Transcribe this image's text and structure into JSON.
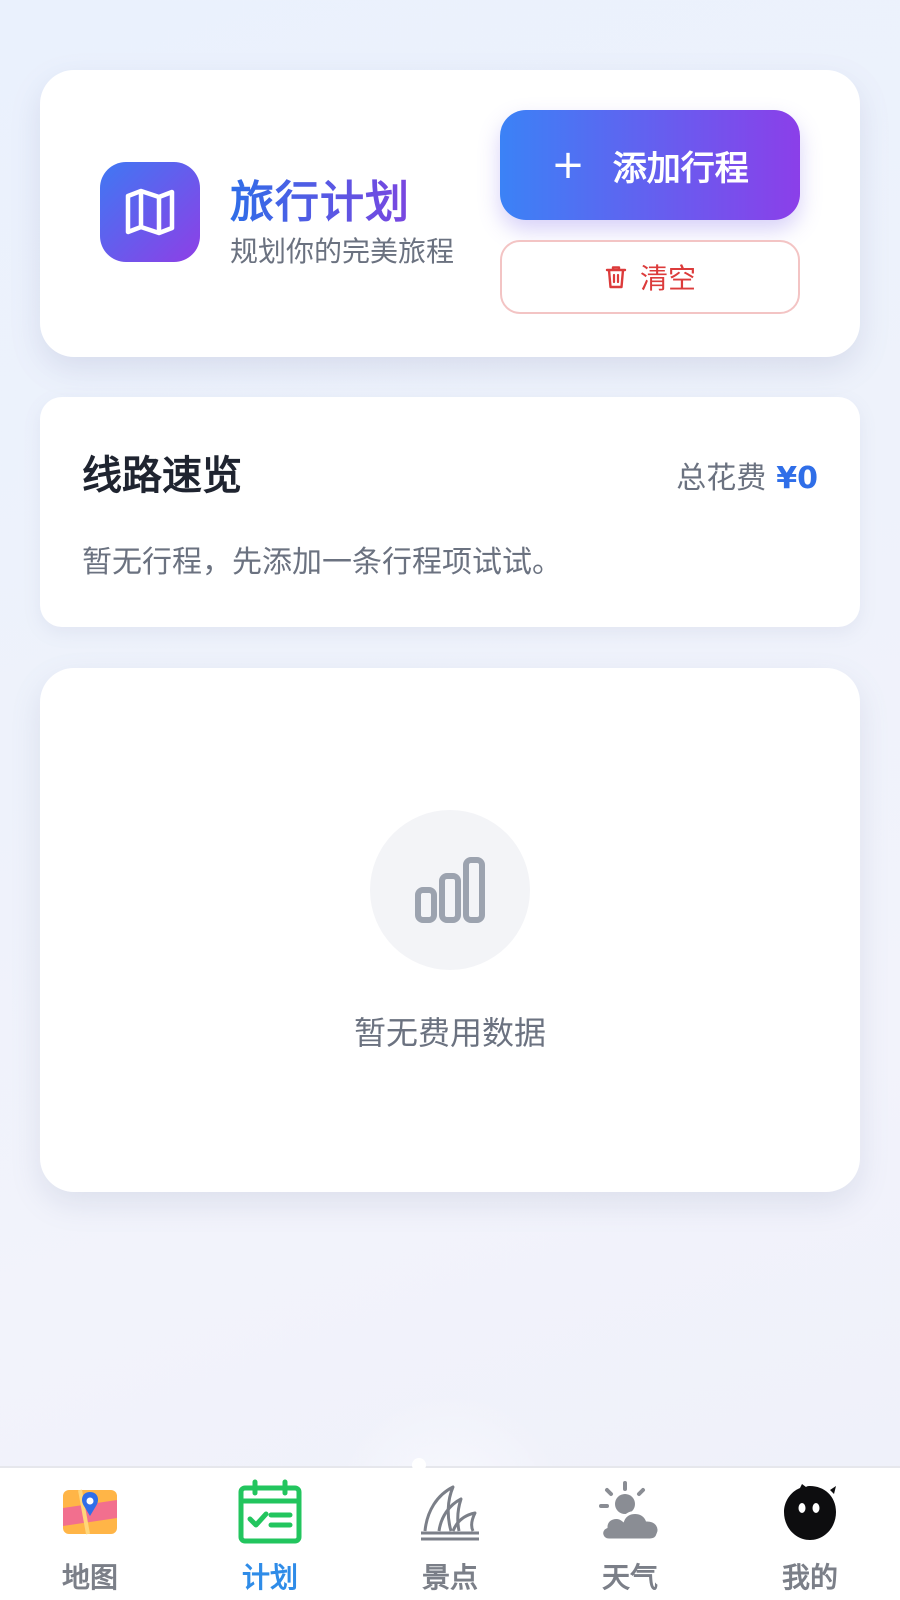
{
  "header": {
    "title": "旅行计划",
    "subtitle": "规划你的完美旅程",
    "add_button": {
      "icon": "plus-icon",
      "label": "添加行程"
    },
    "clear_button": {
      "icon": "trash-icon",
      "label": "清空"
    }
  },
  "route": {
    "title": "线路速览",
    "total_label": "总花费",
    "total_amount": "¥0",
    "empty_text": "暂无行程，先添加一条行程项试试。"
  },
  "cost_chart": {
    "icon": "bar-chart-icon",
    "empty_text": "暂无费用数据"
  },
  "tabs": [
    {
      "label": "地图",
      "icon": "map-pin-icon",
      "active": false
    },
    {
      "label": "计划",
      "icon": "calendar-check-icon",
      "active": true
    },
    {
      "label": "景点",
      "icon": "opera-house-icon",
      "active": false
    },
    {
      "label": "天气",
      "icon": "sun-cloud-icon",
      "active": false
    },
    {
      "label": "我的",
      "icon": "avatar-icon",
      "active": false
    }
  ],
  "colors": {
    "brand_gradient_start": "#3b82f6",
    "brand_gradient_end": "#8b3fe9",
    "danger": "#dc3b3b",
    "active_tab": "#2f8ce8",
    "active_tab_icon": "#22c55e"
  }
}
